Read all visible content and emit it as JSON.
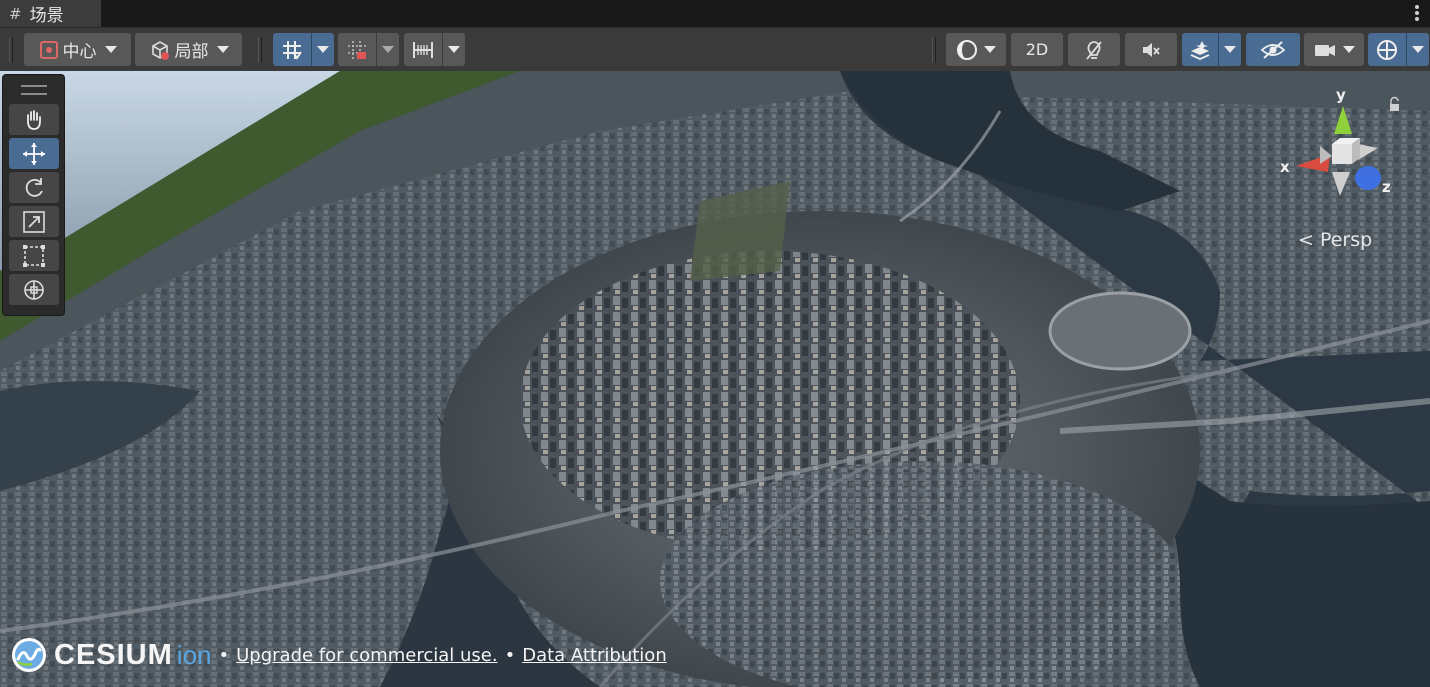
{
  "tab": {
    "icon": "grid-icon",
    "label": "场景"
  },
  "toolbar": {
    "pivot_label": "中心",
    "space_label": "局部",
    "mode_2d_label": "2D"
  },
  "tools": [
    {
      "name": "view-hand-tool",
      "icon": "hand-icon"
    },
    {
      "name": "move-tool",
      "icon": "move-arrows-icon",
      "active": true
    },
    {
      "name": "rotate-tool",
      "icon": "rotate-icon"
    },
    {
      "name": "scale-tool",
      "icon": "scale-icon"
    },
    {
      "name": "rect-tool",
      "icon": "rect-icon"
    },
    {
      "name": "transform-tool",
      "icon": "transform-icon"
    }
  ],
  "gizmo": {
    "x_label": "x",
    "y_label": "y",
    "z_label": "z",
    "projection_label": "< Persp"
  },
  "footer": {
    "brand": "CESIUM",
    "brand_suffix": "ion",
    "separator": "•",
    "upgrade_link": "Upgrade for commercial use.",
    "attribution_link": "Data Attribution"
  },
  "colors": {
    "accent_blue": "#4a6b92",
    "toolbar_bg": "#3a3a3a",
    "axis_x": "#d94a3f",
    "axis_y": "#8ed13b",
    "axis_z": "#3f6fe0",
    "ion_blue": "#5aa6e0"
  }
}
